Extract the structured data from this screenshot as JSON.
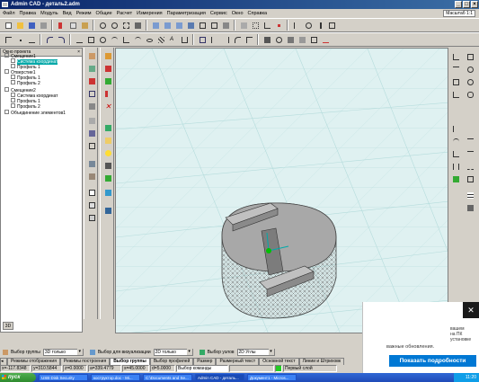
{
  "window": {
    "title": "Admin CAD - деталь2.adm"
  },
  "menu": [
    "Файл",
    "Правка",
    "Модуль",
    "Вид",
    "Режим",
    "Общие",
    "Расчет",
    "Измерения",
    "Параметризация",
    "Сервис",
    "Окно",
    "Справка"
  ],
  "zoom_label": "Масштаб 1:1",
  "tree": {
    "title": "Окно проекта",
    "nodes": [
      "Смещение1",
      "Система координат",
      "Профиль 1",
      "Отверстие1",
      "Профиль 1",
      "Профиль 2",
      "Смещение2",
      "Система координат",
      "Профиль 1",
      "Профиль 2",
      "Объединение элементов1"
    ],
    "view_button": "3D"
  },
  "selection": {
    "group_label": "Выбор группы",
    "group_value": "3D только",
    "visual_label": "Выбор для визуализации",
    "visual_value": "2D только",
    "nodes_label": "Выбор узлов",
    "nodes_value": "2D Углы"
  },
  "tabs": [
    "Режимы отображения",
    "Режимы построения",
    "Выбор группы",
    "Выбор профилей",
    "Размер",
    "Размерный текст",
    "Основной текст",
    "Линии и Штриховк"
  ],
  "active_tab": "Выбор группы",
  "status": {
    "x": "x=-117.8348",
    "y": "y=310.5844",
    "z": "z=0.0000",
    "a": "a=339.4779",
    "s": "s=45.0000",
    "d": "d=5.0000",
    "command": "Выбор команды",
    "layer": "Первый слой"
  },
  "notification": {
    "text1_line1": "вашем",
    "text1_line2": "на ПК",
    "text1_line3": "установке",
    "text2": "важные обновления.",
    "button": "Показать подробности",
    "close": "✕"
  },
  "taskbar": {
    "start": "пуск",
    "items": [
      "USB Disk Security",
      "коструктор.doc - Mi...",
      "C:\\Documents and Se...",
      "Admin CAD - деталь...",
      "Документ1 - Micros..."
    ],
    "clock": "11:20"
  },
  "colors": {
    "viewport_bg": "#dff1f1",
    "grid": "#b8dede",
    "model_fill": "#9a9a9a",
    "selection": "#00a8a8",
    "title_bar": "#0a246a",
    "notify_button": "#0078d4"
  }
}
